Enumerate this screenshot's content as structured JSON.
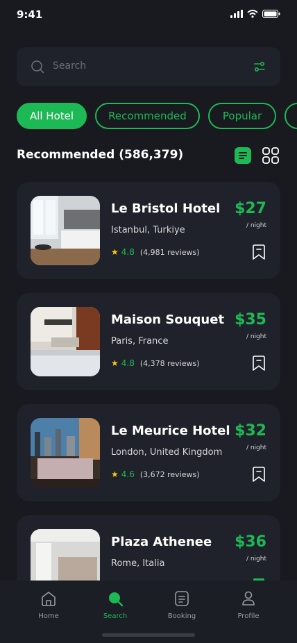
{
  "status": {
    "time": "9:41"
  },
  "search": {
    "placeholder": "Search"
  },
  "chips": [
    "All Hotel",
    "Recommended",
    "Popular"
  ],
  "section": {
    "title": "Recommended (586,379)"
  },
  "hotels": [
    {
      "name": "Le Bristol Hotel",
      "location": "Istanbul, Turkiye",
      "rating": "4.8",
      "reviews": "(4,981 reviews)",
      "price": "$27",
      "per": "/ night"
    },
    {
      "name": "Maison Souquet",
      "location": "Paris, France",
      "rating": "4.8",
      "reviews": "(4,378 reviews)",
      "price": "$35",
      "per": "/ night"
    },
    {
      "name": "Le Meurice Hotel",
      "location": "London, United Kingdom",
      "rating": "4.6",
      "reviews": "(3,672 reviews)",
      "price": "$32",
      "per": "/ night"
    },
    {
      "name": "Plaza Athenee",
      "location": "Rome, Italia",
      "price": "$36",
      "per": "/ night"
    }
  ],
  "tabs": [
    "Home",
    "Search",
    "Booking",
    "Profile"
  ],
  "colors": {
    "accent": "#1db954",
    "background": "#181a20",
    "card": "#1f222a",
    "star": "#facc15"
  }
}
